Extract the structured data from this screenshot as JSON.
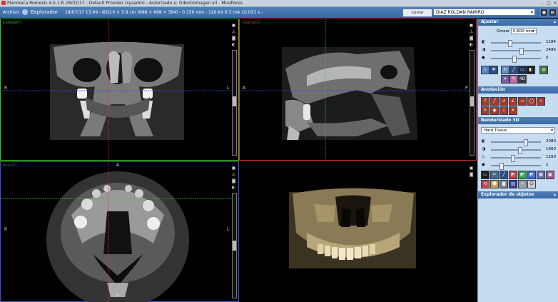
{
  "window": {
    "title": "Planmeca Romexis 4.5.1.R  28/02/17 - Default Provider (sysadm) - Autorizado a: Odontoimagen srl - Miraflores"
  },
  "toolbar": {
    "menu": "Archivo",
    "module": "Explorador",
    "study_info": "18/07/17 13:49 - Ø10.0 × 5.9 cm (668 × 668 × 394) - 0.150 mm - 120 kV 6.3 mA 10.031 s -",
    "close_patient": "Cerrar paciente",
    "patient": "DIAZ ROLDAN RAMIRO"
  },
  "views": {
    "coronal": {
      "label": "Coronal(Y)",
      "left": "R",
      "right": "L"
    },
    "sagittal": {
      "label": "Sagital(X)",
      "left": "A",
      "right": "P"
    },
    "axial": {
      "label": "Axial(Z)",
      "left": "R",
      "right": "L",
      "top": "A",
      "bottom": "P"
    }
  },
  "panel": {
    "adjust": {
      "title": "Ajustar",
      "thickness_label": "Grosor",
      "thickness_value": "0,600 mm",
      "values": [
        "1184",
        "2496",
        "0"
      ]
    },
    "annotation": {
      "title": "Anotación"
    },
    "render3d": {
      "title": "Renderizado 3D",
      "preset": "Hard Tissue",
      "values": [
        "2080",
        "1660",
        "1200",
        "2"
      ]
    },
    "object_explorer": {
      "title": "Explorador de objetos"
    }
  },
  "colors": {
    "accent": "#3a6aa5",
    "panel": "#c6dcf0",
    "coronal_line": "#2ec62e",
    "sagittal_line": "#d63030",
    "axial_line": "#3a4fd6"
  }
}
